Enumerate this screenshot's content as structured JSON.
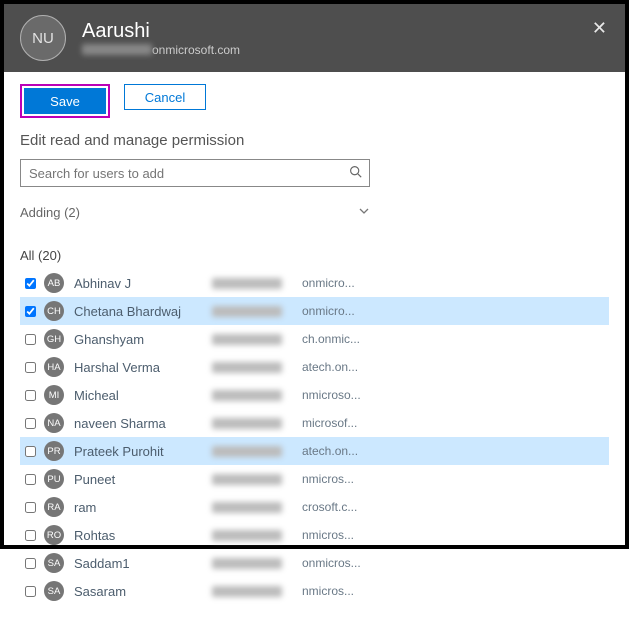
{
  "header": {
    "avatar_initials": "NU",
    "user_name": "Aarushi",
    "email_suffix": "onmicrosoft.com"
  },
  "buttons": {
    "save": "Save",
    "cancel": "Cancel"
  },
  "section_title": "Edit read and manage permission",
  "search": {
    "placeholder": "Search for users to add"
  },
  "adding": {
    "label": "Adding (2)"
  },
  "all_label": "All (20)",
  "users": [
    {
      "initials": "AB",
      "name": "Abhinav J",
      "domain": "onmicro...",
      "checked": true,
      "selected": false
    },
    {
      "initials": "CH",
      "name": "Chetana Bhardwaj",
      "domain": "onmicro...",
      "checked": true,
      "selected": true
    },
    {
      "initials": "GH",
      "name": "Ghanshyam",
      "domain": "ch.onmic...",
      "checked": false,
      "selected": false
    },
    {
      "initials": "HA",
      "name": "Harshal Verma",
      "domain": "atech.on...",
      "checked": false,
      "selected": false
    },
    {
      "initials": "MI",
      "name": "Micheal",
      "domain": "nmicroso...",
      "checked": false,
      "selected": false
    },
    {
      "initials": "NA",
      "name": "naveen Sharma",
      "domain": "microsof...",
      "checked": false,
      "selected": false
    },
    {
      "initials": "PR",
      "name": "Prateek Purohit",
      "domain": "atech.on...",
      "checked": false,
      "selected": true
    },
    {
      "initials": "PU",
      "name": "Puneet",
      "domain": "nmicros...",
      "checked": false,
      "selected": false
    },
    {
      "initials": "RA",
      "name": "ram",
      "domain": "crosoft.c...",
      "checked": false,
      "selected": false
    },
    {
      "initials": "RO",
      "name": "Rohtas",
      "domain": "nmicros...",
      "checked": false,
      "selected": false
    },
    {
      "initials": "SA",
      "name": "Saddam1",
      "domain": "onmicros...",
      "checked": false,
      "selected": false
    },
    {
      "initials": "SA",
      "name": "Sasaram",
      "domain": "nmicros...",
      "checked": false,
      "selected": false
    }
  ]
}
